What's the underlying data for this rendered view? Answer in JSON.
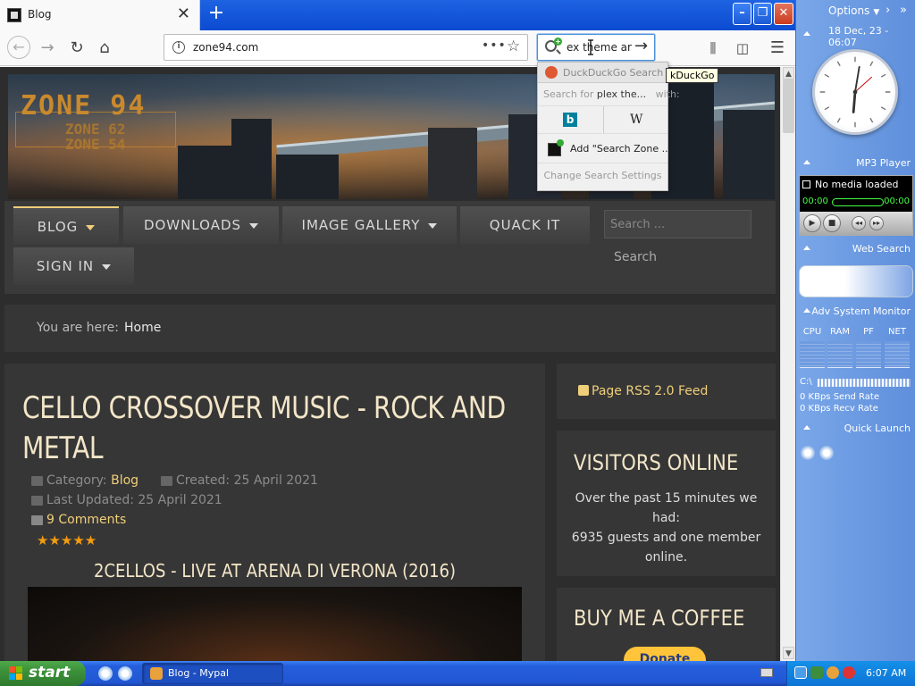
{
  "browser": {
    "tab_title": "Blog",
    "url": "zone94.com",
    "search_text": "ex theme ar",
    "tooltip": "kDuckGo"
  },
  "search_dropdown": {
    "engine_header": "DuckDuckGo Search",
    "search_for_prefix": "Search for",
    "search_for_query": "plex the...",
    "search_for_suffix": "with:",
    "add_label": "Add \"Search Zone ...",
    "settings_label": "Change Search Settings"
  },
  "site": {
    "logo_main": "ZONE 94",
    "logo_sub1": "ZONE 62",
    "logo_sub2": "ZONE 54",
    "menu": [
      {
        "label": "BLOG"
      },
      {
        "label": "DOWNLOADS"
      },
      {
        "label": "IMAGE GALLERY"
      },
      {
        "label": "QUACK IT"
      },
      {
        "label": "SIGN IN"
      }
    ],
    "search_placeholder": "Search ...",
    "search_button": "Search",
    "breadcrumb_label": "You are here:",
    "breadcrumb_home": "Home"
  },
  "article": {
    "title": "CELLO CROSSOVER MUSIC - ROCK AND METAL",
    "category_label": "Category:",
    "category_value": "Blog",
    "created": "Created: 25 April 2021",
    "updated": "Last Updated: 25 April 2021",
    "comments": "9 Comments",
    "rating": 5,
    "stars": "★★★★★",
    "video_title": "2CELLOS - LIVE AT ARENA DI VERONA (2016)"
  },
  "sidebar": {
    "rss": "Page RSS 2.0 Feed",
    "visitors_title": "VISITORS ONLINE",
    "visitors_line1": "Over the past 15 minutes we had:",
    "visitors_line2": "6935 guests and one member online.",
    "coffee_title": "BUY ME A COFFEE",
    "donate": "Donate"
  },
  "panel": {
    "options": "Options",
    "date": "18 Dec, 23 - 06:07",
    "mp3_title": "MP3 Player",
    "mp3_status": "No media loaded",
    "mp3_time_start": "00:00",
    "mp3_time_end": "00:00",
    "websearch_title": "Web Search",
    "sysmon_title": "Adv System Monitor",
    "sysmon_cols": [
      "CPU",
      "RAM",
      "PF",
      "NET"
    ],
    "drive": "C:\\",
    "send_rate": "0 KBps Send Rate",
    "recv_rate": "0 KBps Recv Rate",
    "quicklaunch_title": "Quick Launch"
  },
  "taskbar": {
    "start": "start",
    "task_label": "Blog - Mypal",
    "time": "6:07 AM"
  },
  "colors": {
    "accent_gold": "#f0cf7a",
    "title_cream": "#f3e6c8",
    "xp_blue": "#245edb",
    "start_green": "#3c913a"
  }
}
